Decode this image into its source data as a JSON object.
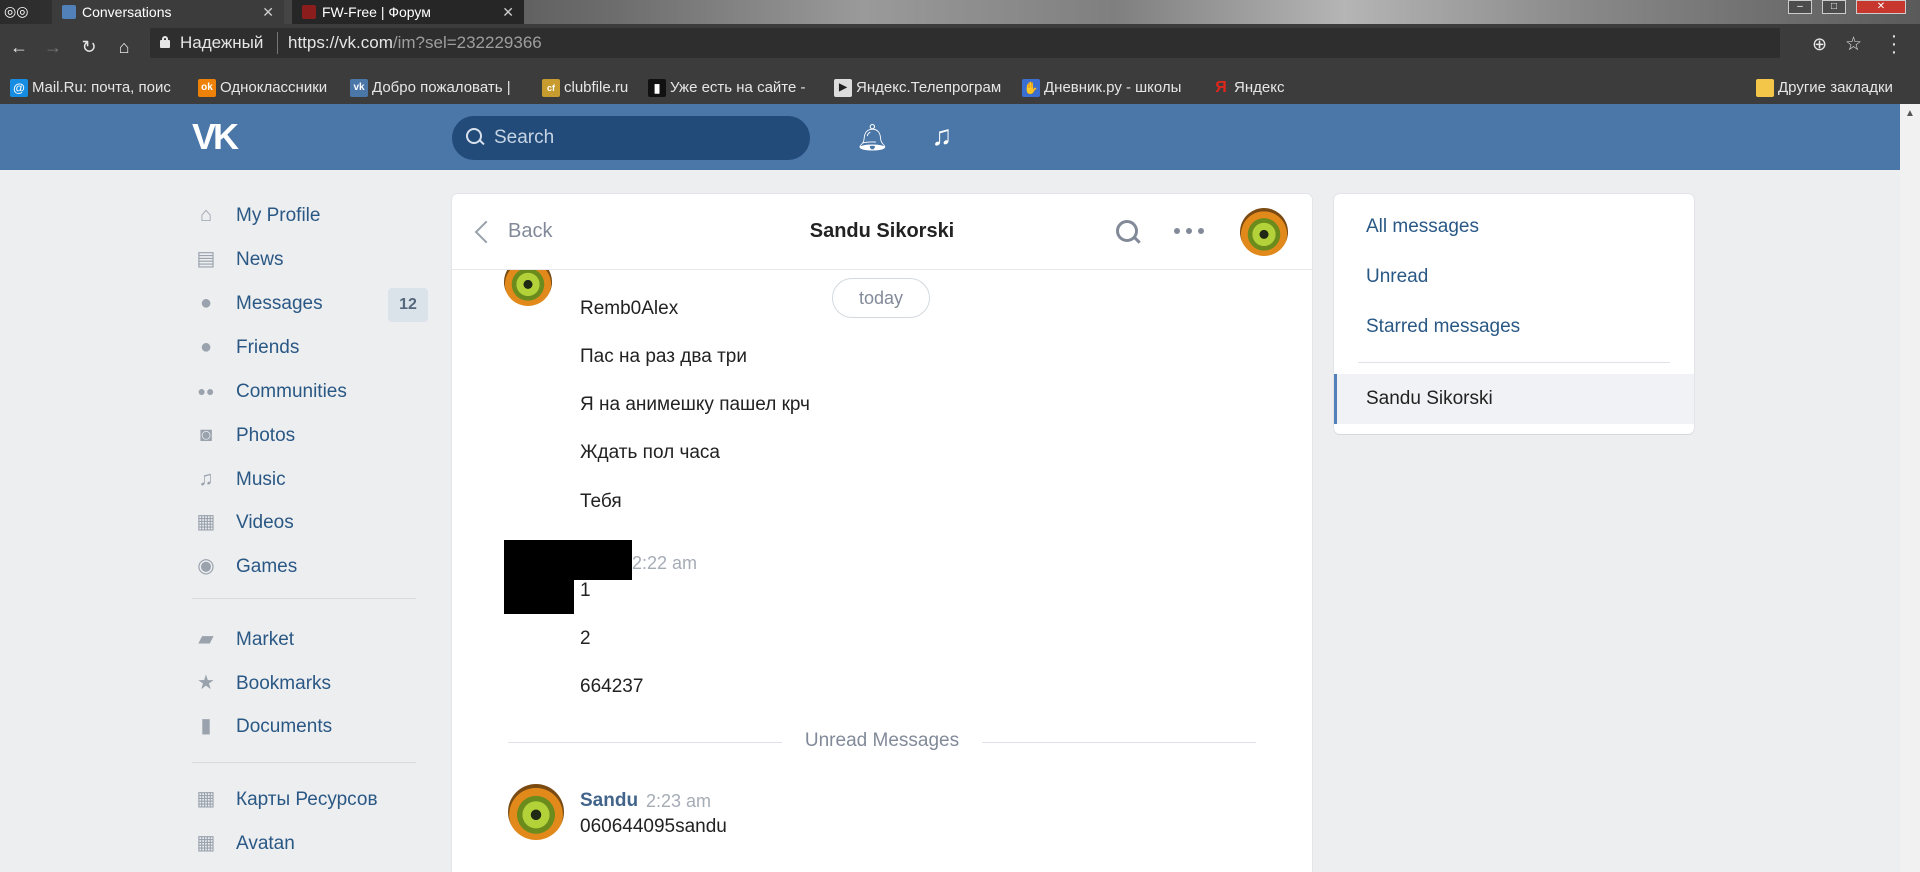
{
  "browser": {
    "tabs": [
      {
        "title": "Conversations",
        "close": "✕"
      },
      {
        "title": "FW-Free | Форум",
        "close": "✕"
      }
    ],
    "secure_label": "Надежный",
    "url_main": "https://vk.com",
    "url_path": "/im?sel=232229366",
    "bookmarks": [
      {
        "label": "Mail.Ru: почта, поис",
        "icon": "@",
        "color": "#168de2"
      },
      {
        "label": "Одноклассники",
        "icon": "ok",
        "color": "#ee8208"
      },
      {
        "label": "Добро пожаловать |",
        "icon": "vk",
        "color": "#4a76a8"
      },
      {
        "label": "clubfile.ru",
        "icon": "cf",
        "color": "#c79b2e"
      },
      {
        "label": "Уже есть на сайте -",
        "icon": "▮",
        "color": "#111111"
      },
      {
        "label": "Яндекс.Телепрограм",
        "icon": "▶",
        "color": "#dddddd"
      },
      {
        "label": "Дневник.ру - школы",
        "icon": "✋",
        "color": "#3a6fd1"
      },
      {
        "label": "Яндекс",
        "icon": "Я",
        "color": "#e1261c"
      }
    ],
    "other_bookmarks": "Другие закладки"
  },
  "header": {
    "search_placeholder": "Search"
  },
  "sidebar": {
    "items": [
      {
        "label": "My Profile",
        "icon": "home-icon",
        "glyph": "⌂"
      },
      {
        "label": "News",
        "icon": "news-icon",
        "glyph": "▤"
      },
      {
        "label": "Messages",
        "icon": "messages-icon",
        "glyph": "●",
        "badge": "12"
      },
      {
        "label": "Friends",
        "icon": "friends-icon",
        "glyph": "●"
      },
      {
        "label": "Communities",
        "icon": "communities-icon",
        "glyph": "●●"
      },
      {
        "label": "Photos",
        "icon": "camera-icon",
        "glyph": "◙"
      },
      {
        "label": "Music",
        "icon": "music-icon",
        "glyph": "♫"
      },
      {
        "label": "Videos",
        "icon": "film-icon",
        "glyph": "▦"
      },
      {
        "label": "Games",
        "icon": "gamepad-icon",
        "glyph": "◉"
      },
      {
        "label": "Market",
        "icon": "bag-icon",
        "glyph": "▰"
      },
      {
        "label": "Bookmarks",
        "icon": "star-icon",
        "glyph": "★"
      },
      {
        "label": "Documents",
        "icon": "document-icon",
        "glyph": "▮"
      },
      {
        "label": "Карты Ресурсов",
        "icon": "app-grid-icon",
        "glyph": "▦"
      },
      {
        "label": "Avatan",
        "icon": "app-grid-icon",
        "glyph": "▦"
      }
    ]
  },
  "chat": {
    "back_label": "Back",
    "title": "Sandu Sikorski",
    "date_pill": "today",
    "earlier_messages": [
      "Remb0Alex",
      "Пас на раз два три",
      "Я на анимешку пашел крч",
      "Ждать пол часа",
      "Тебя"
    ],
    "group2_time": "2:22 am",
    "group2_messages": [
      "1",
      "2",
      "664237"
    ],
    "unread_label": "Unread Messages",
    "last_author": "Sandu",
    "last_time": "2:23 am",
    "last_message": "060644095sandu"
  },
  "right_panel": {
    "all_messages": "All messages",
    "unread": "Unread",
    "starred": "Starred messages",
    "active_conversation": "Sandu Sikorski"
  }
}
